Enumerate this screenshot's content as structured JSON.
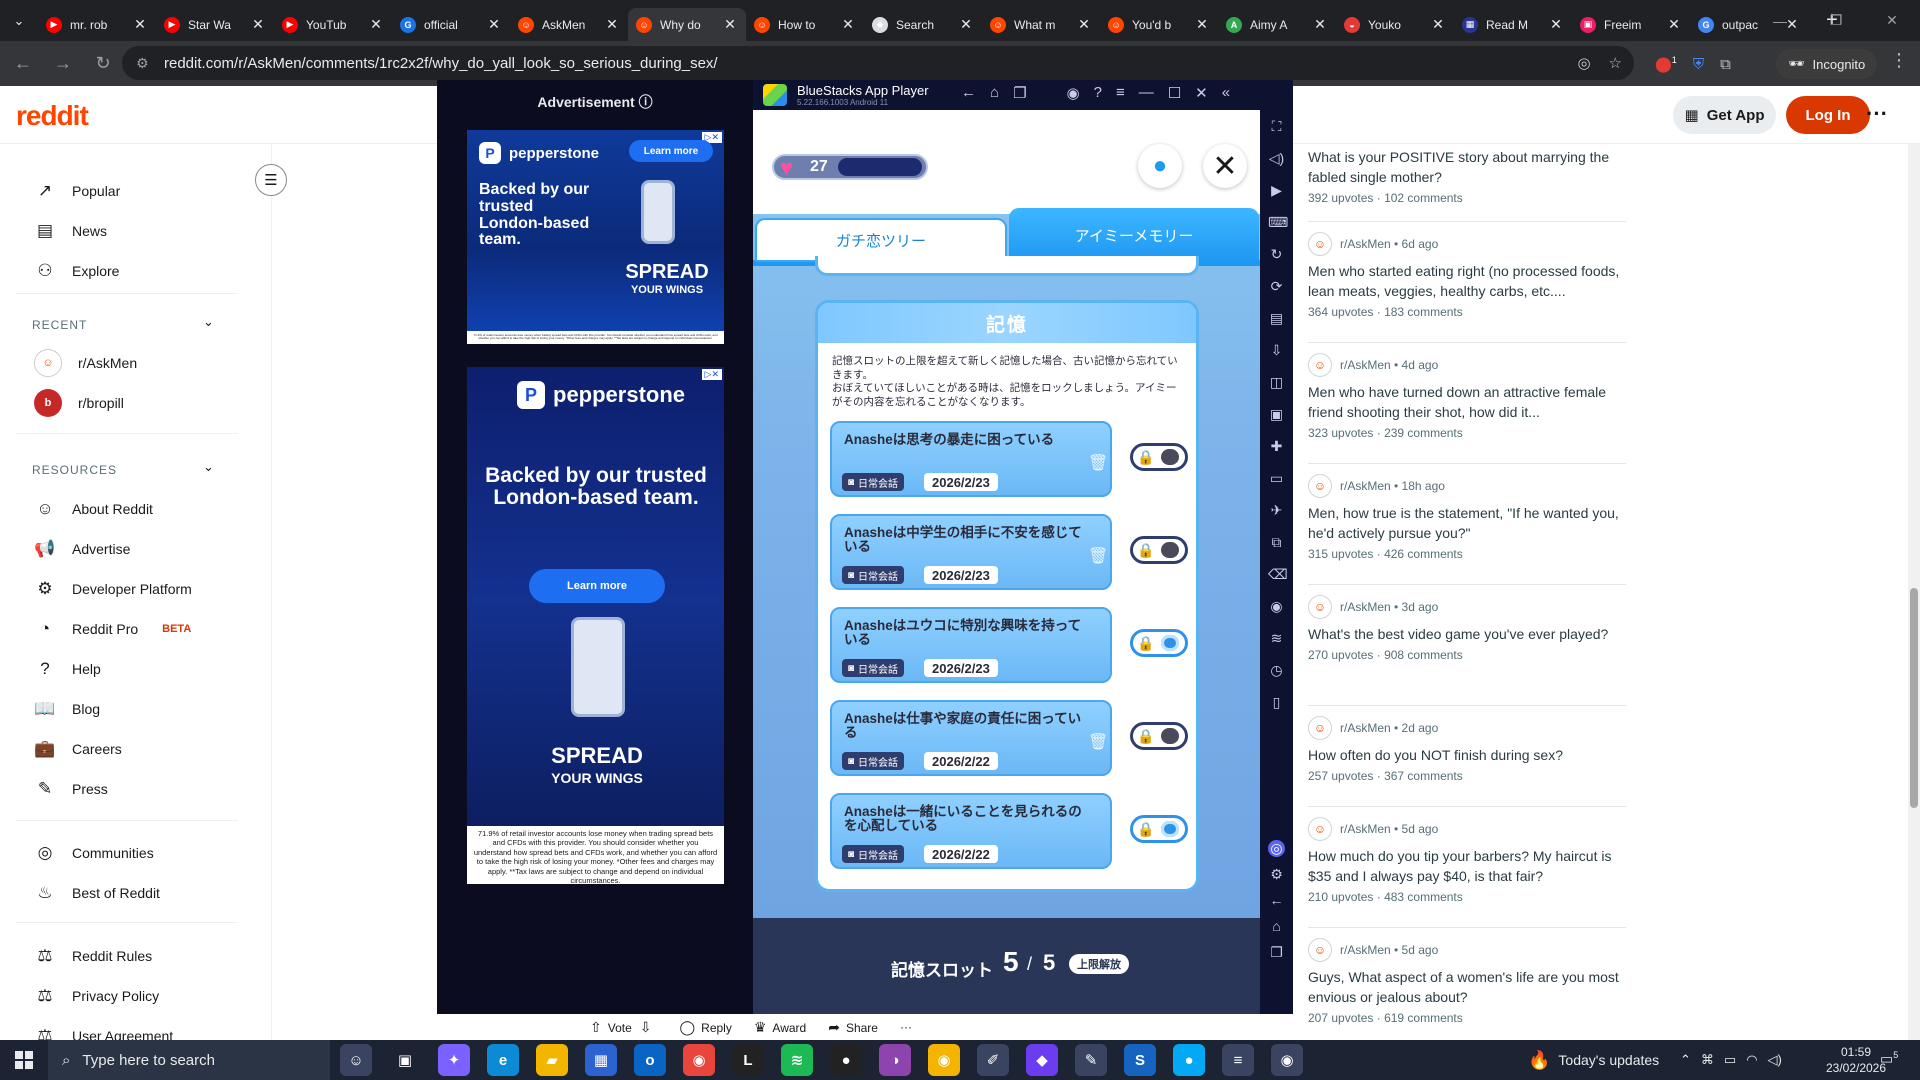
{
  "browser": {
    "tabs": [
      {
        "title": "mr. rob",
        "fav_color": "#ff0000",
        "fav_glyph": "▶"
      },
      {
        "title": "Star Wa",
        "fav_color": "#ff0000",
        "fav_glyph": "▶"
      },
      {
        "title": "YouTub",
        "fav_color": "#ff0000",
        "fav_glyph": "▶"
      },
      {
        "title": "official",
        "fav_color": "#1a73e8",
        "fav_glyph": "G"
      },
      {
        "title": "AskMen",
        "fav_color": "#ff4500",
        "fav_glyph": "☺"
      },
      {
        "title": "Why do",
        "fav_color": "#ff4500",
        "fav_glyph": "☺",
        "active": true
      },
      {
        "title": "How to",
        "fav_color": "#ff4500",
        "fav_glyph": "☺"
      },
      {
        "title": "Search",
        "fav_color": "#dadce0",
        "fav_glyph": "◆"
      },
      {
        "title": "What m",
        "fav_color": "#ff4500",
        "fav_glyph": "☺"
      },
      {
        "title": "You'd b",
        "fav_color": "#ff4500",
        "fav_glyph": "☺"
      },
      {
        "title": "Aimy A",
        "fav_color": "#34a853",
        "fav_glyph": "A"
      },
      {
        "title": "Youko",
        "fav_color": "#e53935",
        "fav_glyph": "◒"
      },
      {
        "title": "Read M",
        "fav_color": "#283593",
        "fav_glyph": "▦"
      },
      {
        "title": "Freeim",
        "fav_color": "#e91e63",
        "fav_glyph": "▣"
      },
      {
        "title": "outpac",
        "fav_color": "#4285f4",
        "fav_glyph": "G"
      }
    ],
    "url": "reddit.com/r/AskMen/comments/1rc2x2f/why_do_yall_look_so_serious_during_sex/",
    "incognito_label": "Incognito",
    "extension_badge": "1"
  },
  "reddit": {
    "logo": "reddit",
    "get_app": "Get App",
    "login": "Log In",
    "nav": [
      {
        "label": "Popular",
        "icon": "↗"
      },
      {
        "label": "News",
        "icon": "▤"
      },
      {
        "label": "Explore",
        "icon": "⚇"
      }
    ],
    "recent_heading": "RECENT",
    "recent": [
      {
        "label": "r/AskMen",
        "color": "#ffffff",
        "glyph": "☺"
      },
      {
        "label": "r/bropill",
        "color": "#c62828",
        "glyph": "b"
      }
    ],
    "resources_heading": "RESOURCES",
    "resources": [
      {
        "label": "About Reddit",
        "icon": "☺"
      },
      {
        "label": "Advertise",
        "icon": "📢"
      },
      {
        "label": "Developer Platform",
        "icon": "⚙"
      },
      {
        "label": "Reddit Pro",
        "icon": "◔",
        "badge": "BETA"
      },
      {
        "label": "Help",
        "icon": "?"
      },
      {
        "label": "Blog",
        "icon": "📖"
      },
      {
        "label": "Careers",
        "icon": "💼"
      },
      {
        "label": "Press",
        "icon": "✎"
      }
    ],
    "extra": [
      {
        "label": "Communities",
        "icon": "◎"
      },
      {
        "label": "Best of Reddit",
        "icon": "♨"
      }
    ],
    "policies": [
      {
        "label": "Reddit Rules",
        "icon": "⚖"
      },
      {
        "label": "Privacy Policy",
        "icon": "⚖"
      },
      {
        "label": "User Agreement",
        "icon": "⚖"
      }
    ],
    "actions": {
      "vote": "Vote",
      "reply": "Reply",
      "award": "Award",
      "share": "Share",
      "more": "···"
    },
    "rail_posts": [
      {
        "meta": "",
        "title": "What is your POSITIVE story about marrying the fabled single mother?",
        "upvotes": "392 upvotes",
        "comments": "102 comments"
      },
      {
        "meta": "r/AskMen • 6d ago",
        "title": "Men who started eating right (no processed foods, lean meats, veggies, healthy carbs, etc....",
        "upvotes": "364 upvotes",
        "comments": "183 comments"
      },
      {
        "meta": "r/AskMen • 4d ago",
        "title": "Men who have turned down an attractive female friend shooting their shot, how did it...",
        "upvotes": "323 upvotes",
        "comments": "239 comments"
      },
      {
        "meta": "r/AskMen • 18h ago",
        "title": "Men, how true is the statement, \"If he wanted you, he'd actively pursue you?\"",
        "upvotes": "315 upvotes",
        "comments": "426 comments"
      },
      {
        "meta": "r/AskMen • 3d ago",
        "title": "What's the best video game you've ever played?",
        "upvotes": "270 upvotes",
        "comments": "908 comments"
      },
      {
        "meta": "r/AskMen • 2d ago",
        "title": "How often do you NOT finish during sex?",
        "upvotes": "257 upvotes",
        "comments": "367 comments"
      },
      {
        "meta": "r/AskMen • 5d ago",
        "title": "How much do you tip your barbers? My haircut is $35 and I always pay $40, is that fair?",
        "upvotes": "210 upvotes",
        "comments": "483 comments"
      },
      {
        "meta": "r/AskMen • 5d ago",
        "title": "Guys, What aspect of a women's life are you most envious or jealous about?",
        "upvotes": "207 upvotes",
        "comments": "619 comments"
      }
    ]
  },
  "ad": {
    "label": "Advertisement",
    "brand": "pepperstone",
    "cta": "Learn more",
    "headline_small": "Backed by our trusted London-based team.",
    "headline_large": "Backed by our trusted London-based team.",
    "spread": "SPREAD",
    "wings": "YOUR WINGS",
    "disclaimer_small": "71.9% of retail investor accounts lose money when trading spread bets and CFDs with this provider. You should consider whether you understand how spread bets and CFDs work, and whether you can afford to take the high risk of losing your money. *Other fees and charges may apply. **Tax laws are subject to change and depend on individual circumstances.",
    "disclaimer_large": "71.9% of retail investor accounts lose money when trading spread bets and CFDs with this provider. You should consider whether you understand how spread bets and CFDs work, and whether you can afford to take the high risk of losing your money. *Other fees and charges may apply. **Tax laws are subject to change and depend on individual circumstances."
  },
  "bluestacks": {
    "title": "BlueStacks App Player",
    "version": "5.22.166.1003 Android 11",
    "hearts": "27",
    "tabs": [
      "ガチ恋ツリー",
      "アイミーメモリー"
    ],
    "active_tab": 1,
    "memory_heading": "記憶",
    "memory_desc": [
      "記憶スロットの上限を超えて新しく記憶した場合、古い記憶から忘れていきます。",
      "おぼえていてほしいことがある時は、記憶をロックしましょう。アイミーがその内容を忘れることがなくなります。"
    ],
    "memories": [
      {
        "title": "Anasheは思考の暴走に困っている",
        "tag": "日常会話",
        "date": "2026/2/23",
        "locked": false
      },
      {
        "title": "Anasheは中学生の相手に不安を感じている",
        "tag": "日常会話",
        "date": "2026/2/23",
        "locked": false
      },
      {
        "title": "Anasheはユウコに特別な興味を持っている",
        "tag": "日常会話",
        "date": "2026/2/23",
        "locked": true
      },
      {
        "title": "Anasheは仕事や家庭の責任に困っている",
        "tag": "日常会話",
        "date": "2026/2/22",
        "locked": false
      },
      {
        "title": "Anasheは一緒にいることを見られるのを心配している",
        "tag": "日常会話",
        "date": "2026/2/22",
        "locked": true
      }
    ],
    "slot_label": "記憶スロット",
    "slot_used": "5",
    "slot_sep": "/",
    "slot_max": "5",
    "unlock_label": "上限解放"
  },
  "taskbar": {
    "search_placeholder": "Type here to search",
    "weather": "Today's updates",
    "time": "01:59",
    "date": "23/02/2026",
    "notif_count": "5",
    "apps": [
      {
        "name": "cortana-avatar",
        "color": "#3a4460",
        "glyph": "☺"
      },
      {
        "name": "task-view",
        "color": "transparent",
        "glyph": "▣"
      },
      {
        "name": "copilot",
        "color": "#7b61ff",
        "glyph": "✦"
      },
      {
        "name": "edge",
        "color": "#0c8ad3",
        "glyph": "e"
      },
      {
        "name": "file-explorer",
        "color": "#f2b600",
        "glyph": "▰"
      },
      {
        "name": "store",
        "color": "#2c63d0",
        "glyph": "▦"
      },
      {
        "name": "outlook",
        "color": "#0a64c4",
        "glyph": "o"
      },
      {
        "name": "chrome",
        "color": "#e8453c",
        "glyph": "◉"
      },
      {
        "name": "live",
        "color": "#222222",
        "glyph": "L"
      },
      {
        "name": "spotify",
        "color": "#1db954",
        "glyph": "≋"
      },
      {
        "name": "app-circle",
        "color": "#222222",
        "glyph": "●"
      },
      {
        "name": "app-purple",
        "color": "#8e44ad",
        "glyph": "◑"
      },
      {
        "name": "chrome-alt",
        "color": "#f4b400",
        "glyph": "◉"
      },
      {
        "name": "feather",
        "color": "#3a4460",
        "glyph": "✐"
      },
      {
        "name": "obsidian",
        "color": "#6c3df0",
        "glyph": "◆"
      },
      {
        "name": "app-tool",
        "color": "#3a4460",
        "glyph": "✎"
      },
      {
        "name": "app-blue-s",
        "color": "#1565c0",
        "glyph": "S"
      },
      {
        "name": "app-cyan",
        "color": "#03a9f4",
        "glyph": "●"
      },
      {
        "name": "bluestacks",
        "color": "#3a4460",
        "glyph": "≡"
      },
      {
        "name": "chrome-active",
        "color": "#3a4460",
        "glyph": "◉"
      }
    ]
  }
}
